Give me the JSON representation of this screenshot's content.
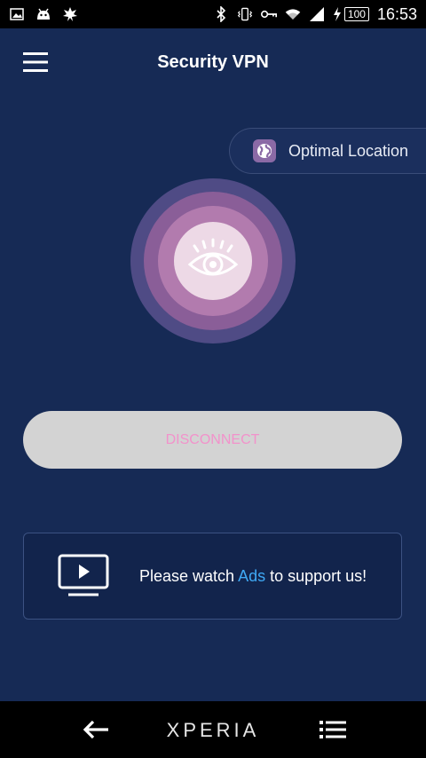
{
  "status_bar": {
    "left_icons": [
      "image-icon",
      "android-icon",
      "leaf-icon"
    ],
    "right_icons": [
      "bluetooth-icon",
      "vibrate-icon",
      "key-icon",
      "wifi-icon",
      "signal-icon",
      "charging-icon"
    ],
    "battery": "100",
    "time": "16:53"
  },
  "app_bar": {
    "title": "Security VPN",
    "menu_icon": "hamburger-menu-icon"
  },
  "location": {
    "label": "Optimal Location",
    "icon": "globe-icon"
  },
  "connection": {
    "button_label": "DISCONNECT",
    "orb_icon": "eye-icon"
  },
  "ads_card": {
    "text_before": "Please watch ",
    "link": "Ads",
    "text_after": " to support us!",
    "icon": "tv-play-icon"
  },
  "nav_bar": {
    "brand": "XPERIA",
    "back_icon": "back-arrow-icon",
    "menu_icon": "list-menu-icon"
  },
  "colors": {
    "background": "#162a55",
    "accent_link": "#3fa9f5",
    "disconnect_text": "#f292cb",
    "button_bg": "#d3d3d3"
  }
}
